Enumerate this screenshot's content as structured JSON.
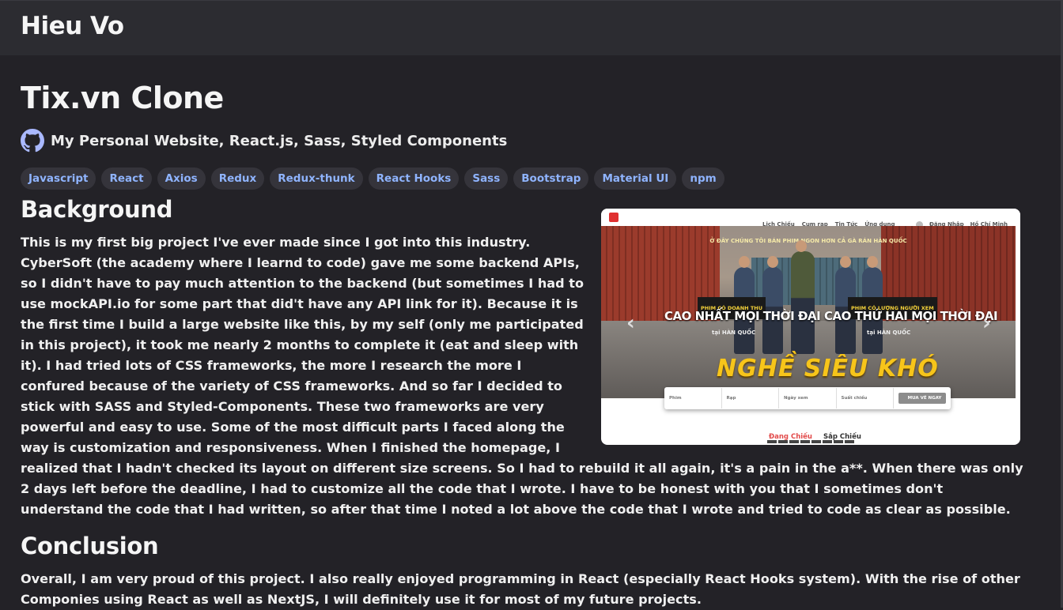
{
  "header": {
    "brand": "Hieu Vo"
  },
  "project": {
    "title": "Tix.vn Clone",
    "subtitle": "My Personal Website, React.js, Sass, Styled Components",
    "tags": [
      "Javascript",
      "React",
      "Axios",
      "Redux",
      "Redux-thunk",
      "React Hooks",
      "Sass",
      "Bootstrap",
      "Material UI",
      "npm"
    ]
  },
  "background": {
    "heading": "Background",
    "text": "This is my first big project I've ever made since I got into this industry. CyberSoft (the academy where I learnd to code) gave me some backend APIs, so I didn't have to pay much attention to the backend (but sometimes I had to use mockAPI.io for some part that did't have any API link for it). Because it is the first time I build a large website like this, by my self (only me participated in this project), it took me nearly 2 months to complete it (eat and sleep with it). I had tried lots of CSS frameworks, the more I research the more I confured because of the variety of CSS frameworks. And so far I decided to stick with SASS and Styled-Components. These two frameworks are very powerful and easy to use. Some of the most difficult parts I faced along the way is customization and responsiveness. When I finished the homepage, I realized that I hadn't checked its layout on different size screens. So I had to rebuild it all again, it's a pain in the a**. When there was only 2 days left before the deadline, I had to customize all the code that I wrote. I have to be honest with you that I sometimes don't understand the code that I had written, so after that time I noted a lot above the code that I wrote and tried to code as clear as possible."
  },
  "screenshot": {
    "nav_links": [
      "Lịch Chiếu",
      "Cụm rạp",
      "Tin Tức",
      "Ứng dụng"
    ],
    "account": [
      "Đăng Nhập",
      "Hồ Chí Minh"
    ],
    "hero_top": "Ở ĐÂY CHÚNG TÔI BÁN PHIM NGON HƠN CẢ GÀ RÁN HÀN QUỐC",
    "badge_left": "PHIM CÓ DOANH THU",
    "line_left": "CAO NHẤT MỌI THỜI ĐẠI",
    "sub_left": "tại HÀN QUỐC",
    "badge_right": "PHIM CÓ LƯỢNG NGƯỜI XEM",
    "line_right": "CAO THỨ HAI MỌI THỜI ĐẠI",
    "sub_right": "tại HÀN QUỐC",
    "hero_title": "NGHỀ SIÊU KHÓ",
    "search_fields": [
      "Phim",
      "Rạp",
      "Ngày xem",
      "Suất chiếu"
    ],
    "buy_label": "MUA VÉ NGAY",
    "tab_active": "Đang Chiếu",
    "tab_inactive": "Sắp Chiếu"
  },
  "conclusion": {
    "heading": "Conclusion",
    "text": "Overall, I am very proud of this project. I also really enjoyed programming in React (especially React Hooks system). With the rise of other Componies using React as well as NextJS, I will definitely use it for most of my future projects."
  },
  "colors": {
    "page_bg": "#232227",
    "header_bg": "#2c2c31",
    "tag_bg": "#35343b",
    "tag_text": "#8fb4ff"
  },
  "icons": {
    "repo": "github-icon"
  }
}
